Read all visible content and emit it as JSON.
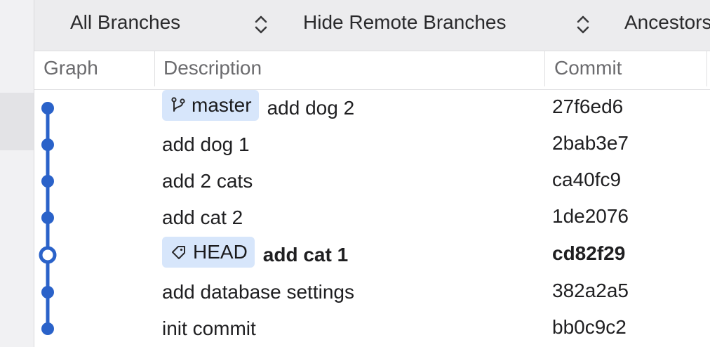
{
  "toolbar": {
    "branches_label": "All Branches",
    "remote_label": "Hide Remote Branches",
    "ancestors_label": "Ancestors"
  },
  "columns": {
    "graph": "Graph",
    "description": "Description",
    "commit": "Commit"
  },
  "commits": [
    {
      "description": "add dog 2",
      "badge": "master",
      "badge_icon": "branch-icon",
      "hash": "27f6ed6",
      "bold": false
    },
    {
      "description": "add dog 1",
      "hash": "2bab3e7",
      "bold": false
    },
    {
      "description": "add 2 cats",
      "hash": "ca40fc9",
      "bold": false
    },
    {
      "description": "add cat 2",
      "hash": "1de2076",
      "bold": false
    },
    {
      "description": "add cat 1",
      "badge": "HEAD",
      "badge_icon": "tag-icon",
      "hash": "cd82f29",
      "bold": true
    },
    {
      "description": "add database settings",
      "hash": "382a2a5",
      "bold": false
    },
    {
      "description": "init commit",
      "hash": "bb0c9c2",
      "bold": false
    }
  ],
  "colors": {
    "graph_line": "#2a62c9",
    "badge_bg": "#d7e6fb"
  }
}
